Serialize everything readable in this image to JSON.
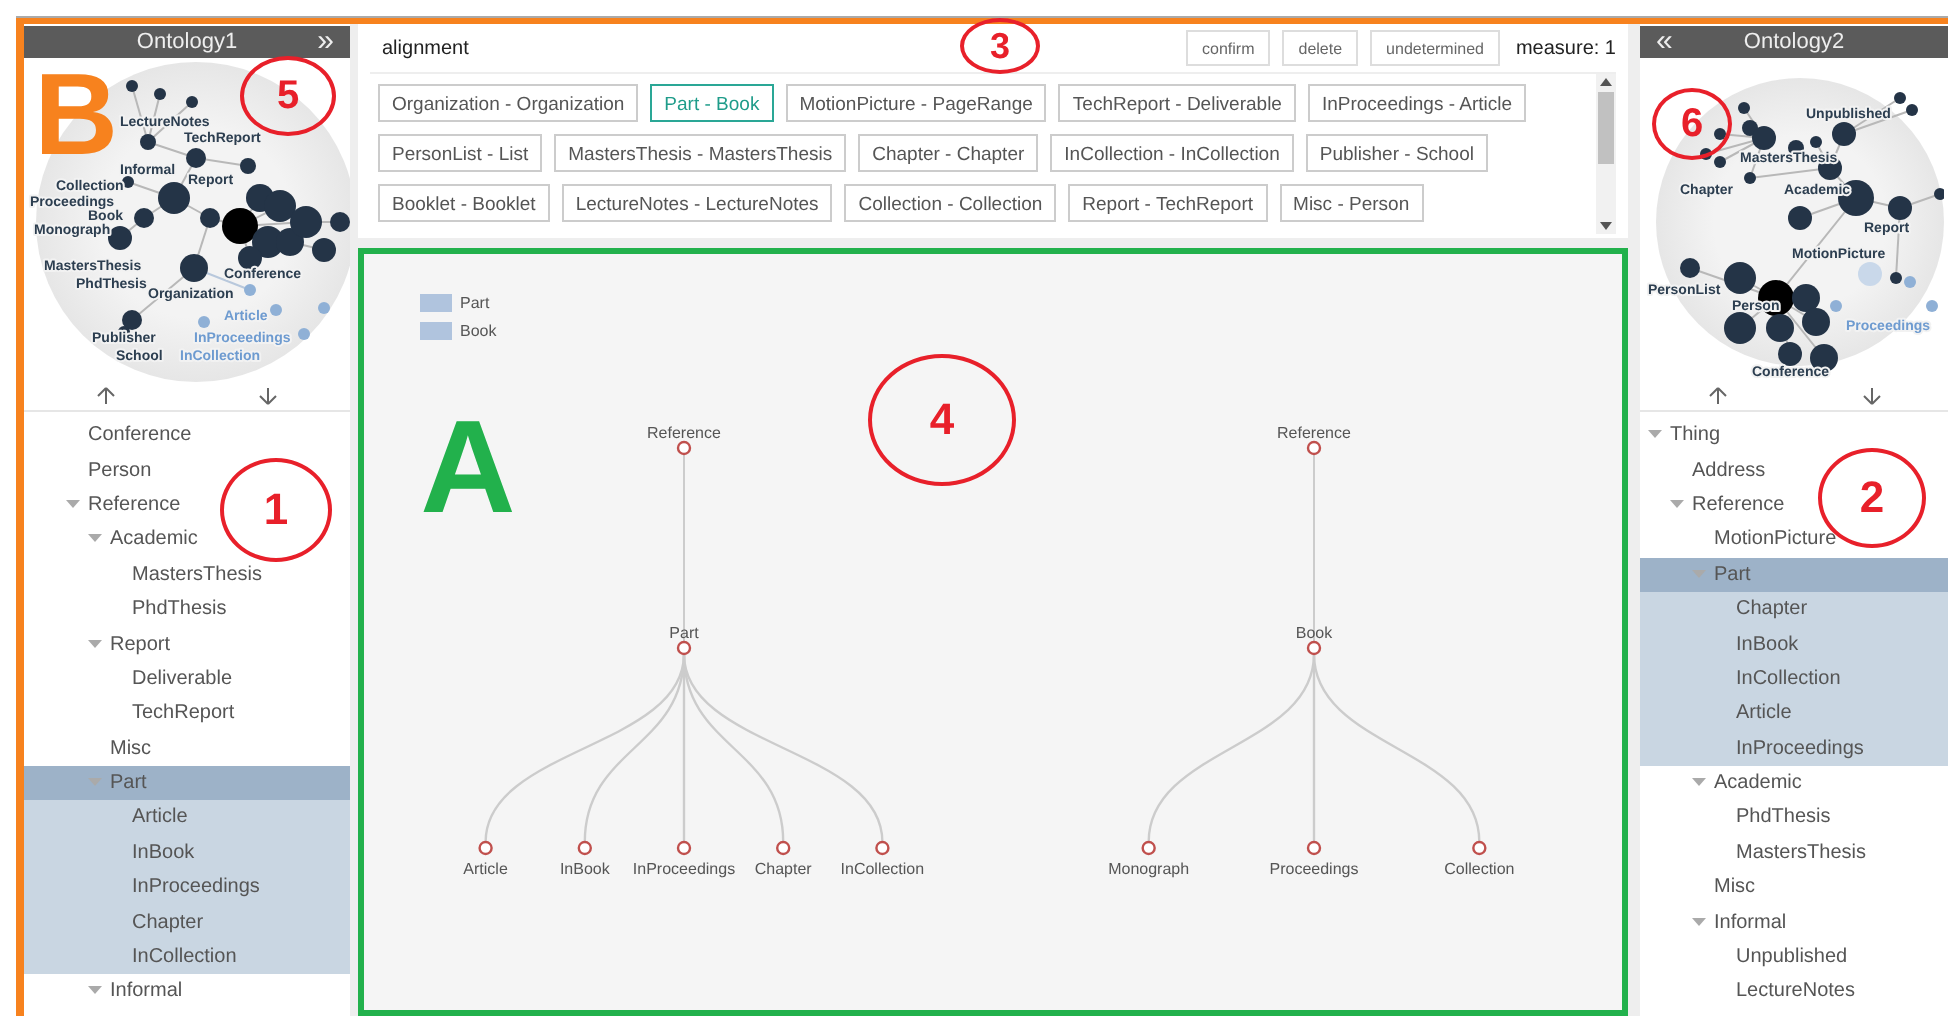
{
  "left_panel": {
    "title": "Ontology1",
    "toggle": "»",
    "graph_labels": [
      {
        "text": "LectureNotes",
        "highlighted": false
      },
      {
        "text": "TechReport",
        "highlighted": false
      },
      {
        "text": "Informal",
        "highlighted": false
      },
      {
        "text": "Report",
        "highlighted": false
      },
      {
        "text": "Collection",
        "highlighted": false
      },
      {
        "text": "Proceedings",
        "highlighted": false
      },
      {
        "text": "Book",
        "highlighted": false
      },
      {
        "text": "Monograph",
        "highlighted": false
      },
      {
        "text": "MastersThesis",
        "highlighted": false
      },
      {
        "text": "Conference",
        "highlighted": false
      },
      {
        "text": "PhdThesis",
        "highlighted": false
      },
      {
        "text": "Organization",
        "highlighted": false
      },
      {
        "text": "Article",
        "highlighted": true
      },
      {
        "text": "Publisher",
        "highlighted": false
      },
      {
        "text": "InProceedings",
        "highlighted": true
      },
      {
        "text": "School",
        "highlighted": false
      },
      {
        "text": "InCollection",
        "highlighted": true
      }
    ],
    "tree": [
      {
        "label": "Conference",
        "selected": false
      },
      {
        "label": "Person",
        "selected": false
      },
      {
        "label": "Reference",
        "selected": false,
        "expanded": true,
        "children": [
          {
            "label": "Academic",
            "selected": false,
            "expanded": true,
            "children": [
              {
                "label": "MastersThesis",
                "selected": false
              },
              {
                "label": "PhdThesis",
                "selected": false
              }
            ]
          },
          {
            "label": "Report",
            "selected": false,
            "expanded": true,
            "children": [
              {
                "label": "Deliverable",
                "selected": false
              },
              {
                "label": "TechReport",
                "selected": false
              }
            ]
          },
          {
            "label": "Misc",
            "selected": false
          },
          {
            "label": "Part",
            "selected": true,
            "expanded": true,
            "children": [
              {
                "label": "Article",
                "selected": false
              },
              {
                "label": "InBook",
                "selected": false
              },
              {
                "label": "InProceedings",
                "selected": false
              },
              {
                "label": "Chapter",
                "selected": false
              },
              {
                "label": "InCollection",
                "selected": false
              }
            ]
          },
          {
            "label": "Informal",
            "selected": false,
            "expanded": true
          }
        ]
      }
    ]
  },
  "alignment": {
    "title": "alignment",
    "buttons": [
      "confirm",
      "delete",
      "undetermined"
    ],
    "measure": "measure: 1",
    "pairs": [
      {
        "label": "Organization - Organization",
        "selected": false
      },
      {
        "label": "Part - Book",
        "selected": true
      },
      {
        "label": "MotionPicture - PageRange",
        "selected": false
      },
      {
        "label": "TechReport - Deliverable",
        "selected": false
      },
      {
        "label": "InProceedings - Article",
        "selected": false
      },
      {
        "label": "PersonList - List",
        "selected": false
      },
      {
        "label": "MastersThesis - MastersThesis",
        "selected": false
      },
      {
        "label": "Chapter - Chapter",
        "selected": false
      },
      {
        "label": "InCollection - InCollection",
        "selected": false
      },
      {
        "label": "Publisher - School",
        "selected": false
      },
      {
        "label": "Booklet - Booklet",
        "selected": false
      },
      {
        "label": "LectureNotes - LectureNotes",
        "selected": false
      },
      {
        "label": "Collection - Collection",
        "selected": false
      },
      {
        "label": "Report - TechReport",
        "selected": false
      },
      {
        "label": "Misc - Person",
        "selected": false
      }
    ]
  },
  "comparison": {
    "legend": [
      "Part",
      "Book"
    ],
    "trees": [
      {
        "label": "Reference",
        "children": [
          {
            "label": "Part",
            "children": [
              {
                "label": "Article"
              },
              {
                "label": "InBook"
              },
              {
                "label": "InProceedings"
              },
              {
                "label": "Chapter"
              },
              {
                "label": "InCollection"
              }
            ]
          }
        ]
      },
      {
        "label": "Reference",
        "children": [
          {
            "label": "Book",
            "children": [
              {
                "label": "Monograph"
              },
              {
                "label": "Proceedings"
              },
              {
                "label": "Collection"
              }
            ]
          }
        ]
      }
    ]
  },
  "right_panel": {
    "title": "Ontology2",
    "toggle": "«",
    "graph_labels": [
      {
        "text": "Unpublished",
        "highlighted": false
      },
      {
        "text": "MastersThesis",
        "highlighted": false
      },
      {
        "text": "Chapter",
        "highlighted": false
      },
      {
        "text": "Academic",
        "highlighted": false
      },
      {
        "text": "Report",
        "highlighted": false
      },
      {
        "text": "MotionPicture",
        "highlighted": false
      },
      {
        "text": "PersonList",
        "highlighted": false
      },
      {
        "text": "Person",
        "highlighted": false
      },
      {
        "text": "Proceedings",
        "highlighted": true
      },
      {
        "text": "Conference",
        "highlighted": false
      }
    ],
    "tree": [
      {
        "label": "Thing",
        "selected": false,
        "expanded": true,
        "children": [
          {
            "label": "Address",
            "selected": false
          },
          {
            "label": "Reference",
            "selected": false,
            "expanded": true,
            "children": [
              {
                "label": "MotionPicture",
                "selected": false
              },
              {
                "label": "Part",
                "selected": true,
                "expanded": true,
                "children": [
                  {
                    "label": "Chapter",
                    "selected": false
                  },
                  {
                    "label": "InBook",
                    "selected": false
                  },
                  {
                    "label": "InCollection",
                    "selected": false
                  },
                  {
                    "label": "Article",
                    "selected": false
                  },
                  {
                    "label": "InProceedings",
                    "selected": false
                  }
                ]
              },
              {
                "label": "Academic",
                "selected": false,
                "expanded": true,
                "children": [
                  {
                    "label": "PhdThesis",
                    "selected": false
                  },
                  {
                    "label": "MastersThesis",
                    "selected": false
                  }
                ]
              },
              {
                "label": "Misc",
                "selected": false
              },
              {
                "label": "Informal",
                "selected": false,
                "expanded": true,
                "children": [
                  {
                    "label": "Unpublished",
                    "selected": false
                  },
                  {
                    "label": "LectureNotes",
                    "selected": false
                  }
                ]
              }
            ]
          }
        ]
      }
    ]
  },
  "annotations": [
    {
      "kind": "letter",
      "text": "B",
      "color": "#f7821e"
    },
    {
      "kind": "circled",
      "text": "5"
    },
    {
      "kind": "circled",
      "text": "3"
    },
    {
      "kind": "circled",
      "text": "6"
    },
    {
      "kind": "letter",
      "text": "A",
      "color": "#22b14c"
    },
    {
      "kind": "circled",
      "text": "4"
    },
    {
      "kind": "circled",
      "text": "1"
    },
    {
      "kind": "circled",
      "text": "2"
    }
  ]
}
